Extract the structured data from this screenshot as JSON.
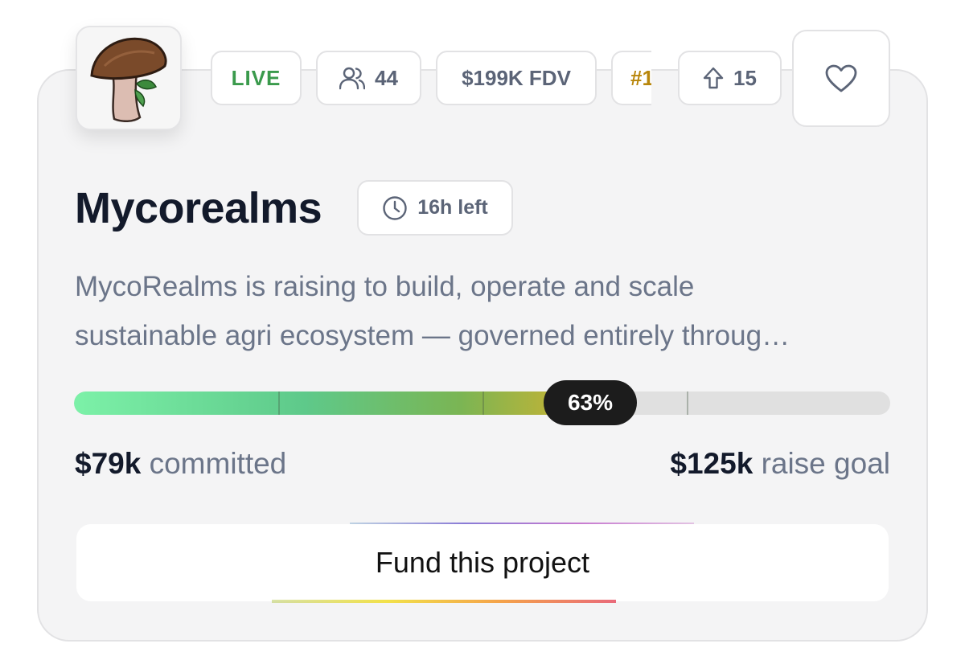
{
  "badges": {
    "status": "LIVE",
    "participants": "44",
    "fdv": "$199K FDV",
    "rank": "#1",
    "upvotes": "15"
  },
  "project": {
    "name": "Mycorealms",
    "time_left": "16h left",
    "description_line1": "MycoRealms is raising to build, operate and scale",
    "description_line2": "sustainable agri ecosystem — governed entirely throug…"
  },
  "progress": {
    "percent_label": "63%",
    "fraction": 0.63,
    "committed_amount": "$79k",
    "committed_label": "committed",
    "goal_amount": "$125k",
    "goal_label": "raise goal"
  },
  "actions": {
    "fund_label": "Fund this project"
  },
  "icons": {
    "logo": "mushroom-logo-icon",
    "participants": "users-icon",
    "upvote": "arrow-up-icon",
    "favorite": "heart-icon",
    "time": "clock-icon"
  },
  "colors": {
    "live": "#3a9a4c",
    "rank": "#b8860b",
    "title": "#131a2b",
    "muted": "#6b7589",
    "progress_start": "#7cf1a8",
    "progress_end": "#d2b22f",
    "badge_bg": "#1c1c1c"
  }
}
